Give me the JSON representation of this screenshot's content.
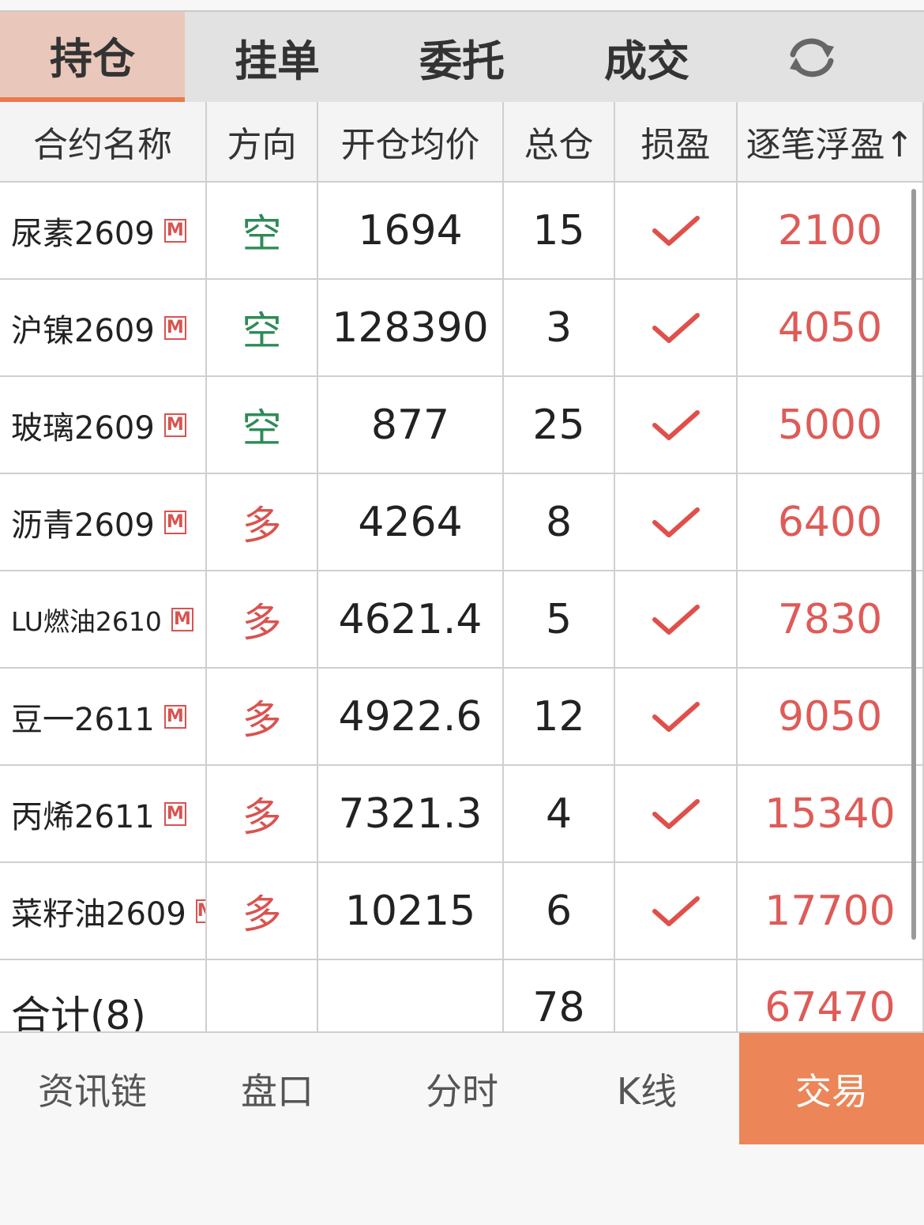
{
  "tabs": [
    {
      "label": "持仓",
      "active": true
    },
    {
      "label": "挂单",
      "active": false
    },
    {
      "label": "委托",
      "active": false
    },
    {
      "label": "成交",
      "active": false
    }
  ],
  "refresh_icon": "refresh-icon",
  "columns": [
    "合约名称",
    "方向",
    "开仓均价",
    "总仓",
    "损盈",
    "逐笔浮盈↑"
  ],
  "badge_letter": "M",
  "rows": [
    {
      "name": "尿素2609",
      "direction": "空",
      "price": "1694",
      "qty": "15",
      "pnl": "2100"
    },
    {
      "name": "沪镍2609",
      "direction": "空",
      "price": "128390",
      "qty": "3",
      "pnl": "4050"
    },
    {
      "name": "玻璃2609",
      "direction": "空",
      "price": "877",
      "qty": "25",
      "pnl": "5000"
    },
    {
      "name": "沥青2609",
      "direction": "多",
      "price": "4264",
      "qty": "8",
      "pnl": "6400"
    },
    {
      "name": "LU燃油2610",
      "direction": "多",
      "price": "4621.4",
      "qty": "5",
      "pnl": "7830"
    },
    {
      "name": "豆一2611",
      "direction": "多",
      "price": "4922.6",
      "qty": "12",
      "pnl": "9050"
    },
    {
      "name": "丙烯2611",
      "direction": "多",
      "price": "7321.3",
      "qty": "4",
      "pnl": "15340"
    },
    {
      "name": "菜籽油2609",
      "direction": "多",
      "price": "10215",
      "qty": "6",
      "pnl": "17700"
    }
  ],
  "total": {
    "label": "合计(8)",
    "qty": "78",
    "pnl": "67470"
  },
  "bottom_nav": [
    "资讯链",
    "盘口",
    "分时",
    "K线",
    "交易"
  ],
  "colors": {
    "short": "#2e8b57",
    "long": "#d9534f",
    "profit": "#de5b57",
    "accent": "#ec8557",
    "active_tab": "#e9c8bb"
  }
}
